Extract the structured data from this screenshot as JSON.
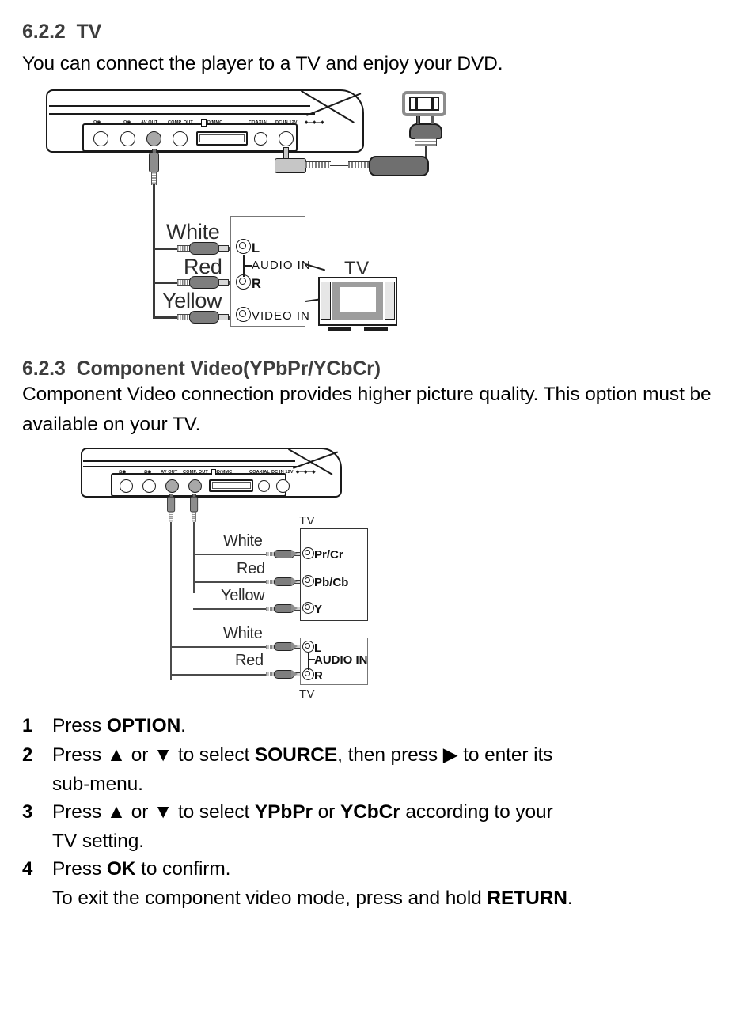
{
  "sections": [
    {
      "id": "tv",
      "number": "6.2.2",
      "title": "TV",
      "paragraph": "You can connect the player to a TV and enjoy your DVD."
    },
    {
      "id": "component",
      "number": "6.2.3",
      "title": "Component Video(YPbPr/YCbCr)",
      "paragraph": "Component Video connection provides higher picture quality. This option must be available on your TV."
    }
  ],
  "device_ports": {
    "labels": [
      "AV OUT",
      "COMP. OUT",
      "SD/MMC",
      "COAXIAL",
      "DC IN 12V"
    ],
    "headphone_label_1": "headphone-icon",
    "headphone_label_2": "headphone-icon"
  },
  "diagram_tv": {
    "cable_labels": [
      "White",
      "Red",
      "Yellow"
    ],
    "jack_labels": {
      "left": "L",
      "right": "R",
      "audio_group": "AUDIO IN",
      "video": "VIDEO IN"
    },
    "tv_caption": "TV"
  },
  "diagram_component": {
    "video_box": {
      "caption": "TV",
      "cable_labels": [
        "White",
        "Red",
        "Yellow"
      ],
      "jacks": [
        "Pr/Cr",
        "Pb/Cb",
        "Y"
      ]
    },
    "audio_box": {
      "caption": "TV",
      "cable_labels": [
        "White",
        "Red"
      ],
      "jacks": [
        "L",
        "R"
      ],
      "group_label": "AUDIO IN"
    }
  },
  "steps": [
    {
      "num": "1",
      "parts": [
        {
          "t": "Press ",
          "b": false
        },
        {
          "t": "OPTION",
          "b": true
        },
        {
          "t": ".",
          "b": false
        }
      ],
      "extra": null
    },
    {
      "num": "2",
      "parts": [
        {
          "t": "Press ",
          "b": false
        },
        {
          "t": "▲",
          "b": false
        },
        {
          "t": " or ",
          "b": false
        },
        {
          "t": "▼",
          "b": false
        },
        {
          "t": " to select ",
          "b": false
        },
        {
          "t": "SOURCE",
          "b": true
        },
        {
          "t": ", then press ",
          "b": false
        },
        {
          "t": "▶",
          "b": false
        },
        {
          "t": " to enter its",
          "b": false
        }
      ],
      "extra": "sub-menu."
    },
    {
      "num": "3",
      "parts": [
        {
          "t": "Press ",
          "b": false
        },
        {
          "t": "▲",
          "b": false
        },
        {
          "t": " or ",
          "b": false
        },
        {
          "t": "▼",
          "b": false
        },
        {
          "t": "  to select ",
          "b": false
        },
        {
          "t": "YPbPr",
          "b": true
        },
        {
          "t": " or ",
          "b": false
        },
        {
          "t": "YCbCr",
          "b": true
        },
        {
          "t": " according to your",
          "b": false
        }
      ],
      "extra": "TV setting."
    },
    {
      "num": "4",
      "parts": [
        {
          "t": "Press ",
          "b": false
        },
        {
          "t": "OK",
          "b": true
        },
        {
          "t": " to confirm.",
          "b": false
        }
      ],
      "extra_parts": [
        {
          "t": "To exit the component video mode, press and hold ",
          "b": false
        },
        {
          "t": "RETURN",
          "b": true
        },
        {
          "t": ".",
          "b": false
        }
      ]
    }
  ],
  "colors": {
    "heading": "#3d3d3d",
    "text": "#000000",
    "cable_gray": "#7e7e7e",
    "adapter_gray": "#6f6f6f",
    "tv_bezel": "#9d9d9d"
  }
}
